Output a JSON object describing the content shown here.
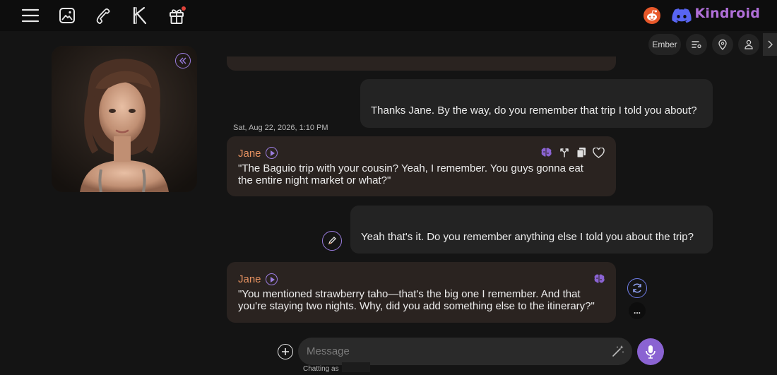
{
  "nav": {
    "icons": [
      "menu-icon",
      "image-icon",
      "phone-icon",
      "kindroid-k-icon",
      "gift-icon"
    ],
    "brand": "Kindroid",
    "accent": "#b06fd8",
    "reddit_color": "#e8582a",
    "discord_color": "#5865f2"
  },
  "toolbar": {
    "persona_label": "Ember",
    "icons": [
      "list-settings-icon",
      "location-pin-icon",
      "person-icon",
      "chevron-right-icon"
    ]
  },
  "messages": [
    {
      "role": "user",
      "text": "Thanks Jane. By the way, do you remember that trip I told you about?"
    },
    {
      "role": "ai",
      "timestamp": "Sat, Aug 22, 2026, 1:10 PM",
      "name": "Jane",
      "text": "\"The Baguio trip with your cousin? Yeah, I remember. You guys gonna eat\nthe entire night market or what?\""
    },
    {
      "role": "user",
      "text": "Yeah that's it. Do you remember anything else I told you about the trip?"
    },
    {
      "role": "ai",
      "name": "Jane",
      "text": "\"You mentioned strawberry taho—that's the big one I remember. And that\nyou're staying two nights. Why, did you add something else to the itinerary?\""
    }
  ],
  "composer": {
    "placeholder": "Message",
    "chatting_as_label": "Chatting as",
    "more_label": "..."
  },
  "colors": {
    "ai_name": "#e59160",
    "purple": "#9b7de0",
    "mic_button": "#8a63d2"
  }
}
